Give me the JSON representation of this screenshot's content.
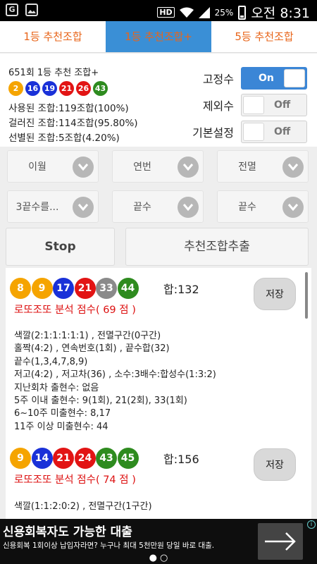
{
  "status_bar": {
    "left_icons": [
      "notification-g-icon",
      "image-icon"
    ],
    "hd": "HD",
    "battery": "25%",
    "time": "오전 8:31"
  },
  "tabs": [
    {
      "label": "1등 추천조합",
      "active": false
    },
    {
      "label": "1등 추천조합+",
      "active": true
    },
    {
      "label": "5등 추천조합",
      "active": false
    }
  ],
  "info": {
    "title": "651회 1등 추천 조합+",
    "balls": [
      {
        "n": "2",
        "color": "#f5a400"
      },
      {
        "n": "16",
        "color": "#1a31d8"
      },
      {
        "n": "19",
        "color": "#1a31d8"
      },
      {
        "n": "21",
        "color": "#e21414"
      },
      {
        "n": "26",
        "color": "#e21414"
      },
      {
        "n": "43",
        "color": "#2e8b1f"
      }
    ],
    "used": "사용된 조합:119조합(100%)",
    "filtered": "걸러진 조합:114조합(95.80%)",
    "selected": "선별된 조합:5조합(4.20%)"
  },
  "toggles": {
    "fixed": {
      "label": "고정수",
      "value": "On"
    },
    "exclude": {
      "label": "제외수",
      "value": "Off"
    },
    "default": {
      "label": "기본설정",
      "value": "Off"
    }
  },
  "dropdowns": {
    "r1": [
      "이월",
      "연번",
      "전멸"
    ],
    "r2": [
      "3끝수를...",
      "끝수",
      "끝수"
    ]
  },
  "buttons": {
    "stop": "Stop",
    "extract": "추천조합추출"
  },
  "results": [
    {
      "balls": [
        {
          "n": "8",
          "color": "#f5a400"
        },
        {
          "n": "9",
          "color": "#f5a400"
        },
        {
          "n": "17",
          "color": "#1a31d8"
        },
        {
          "n": "21",
          "color": "#e21414"
        },
        {
          "n": "33",
          "color": "#8a8a8a"
        },
        {
          "n": "44",
          "color": "#2e8b1f"
        }
      ],
      "sum": "합:132",
      "score": "로또조또 분석 점수( 69 점 )",
      "save": "저장",
      "details": [
        "색깔(2:1:1:1:1:1) , 전멸구간(0구간)",
        "홀짝(4:2) , 연속번호(1회) , 끝수합(32)",
        "끝수(1,3,4,7,8,9)",
        "저고(4:2) , 저고차(36) , 소수:3배수:합성수(1:3:2)",
        "지난회차 출현수: 없음",
        "5주 이내 출현수: 9(1회), 21(2회), 33(1회)",
        "6~10주 미출현수: 8,17",
        "11주 이상 미출현수: 44"
      ]
    },
    {
      "balls": [
        {
          "n": "9",
          "color": "#f5a400"
        },
        {
          "n": "14",
          "color": "#1a31d8"
        },
        {
          "n": "21",
          "color": "#e21414"
        },
        {
          "n": "24",
          "color": "#e21414"
        },
        {
          "n": "43",
          "color": "#2e8b1f"
        },
        {
          "n": "45",
          "color": "#2e8b1f"
        }
      ],
      "sum": "합:156",
      "score": "로또조또 분석 점수( 74 점 )",
      "save": "저장",
      "details": [
        "색깔(1:1:2:0:2) , 전멸구간(1구간)"
      ]
    }
  ],
  "ad": {
    "title": "신용회복자도 가능한 대출",
    "subtitle": "신용회복 1회이상 납입자라면? 누구나 최대 5천만원 당일 바로 대출.",
    "info_icon": "i",
    "arrow_icon": "arrow-right-icon"
  }
}
